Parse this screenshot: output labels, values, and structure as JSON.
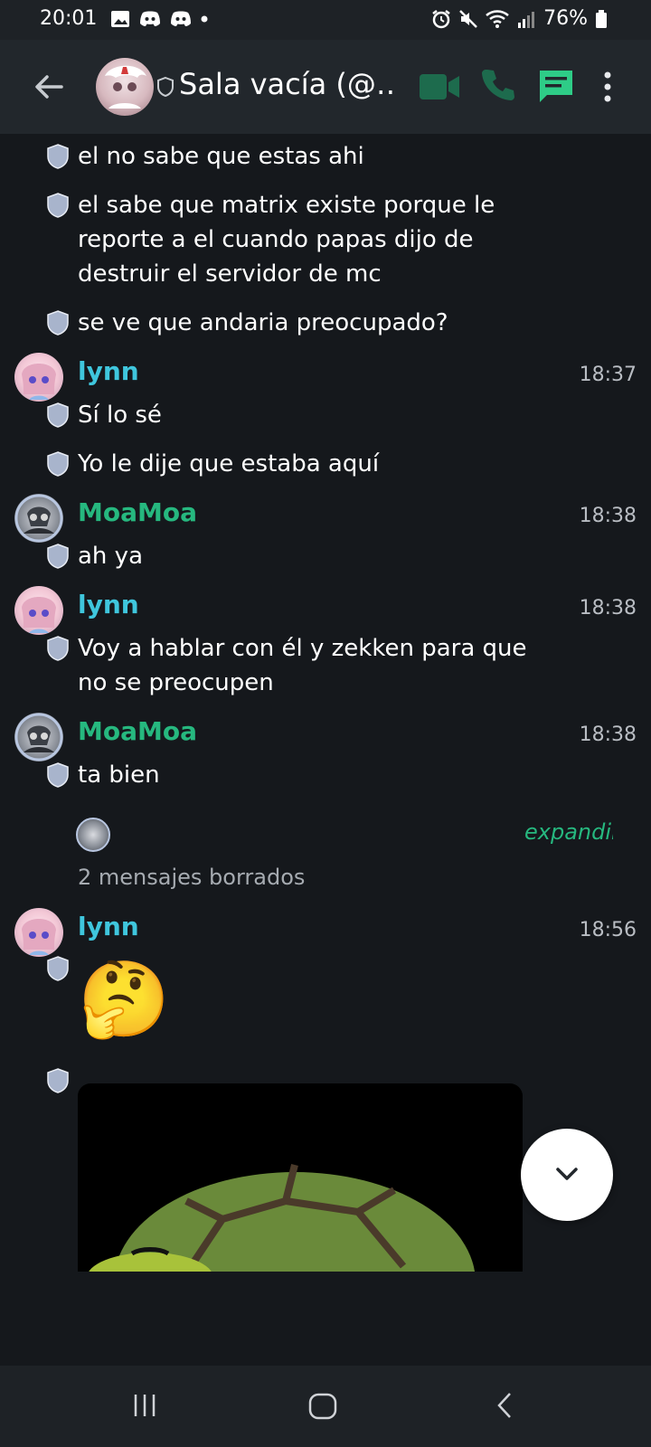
{
  "status_bar": {
    "time": "20:01",
    "battery": "76%"
  },
  "header": {
    "room_title": "Sala vacía (@…"
  },
  "colors": {
    "accent_green": "#26b87f",
    "lynn_name": "#3fc6dd"
  },
  "messages": [
    {
      "text": "el no sabe que estas ahi"
    },
    {
      "text": "el sabe que matrix existe porque le reporte a el cuando papas dijo de destruir el servidor de mc"
    },
    {
      "text": "se ve que andaria preocupado?"
    },
    {
      "sender": "lynn",
      "time": "18:37",
      "text": "Sí lo sé"
    },
    {
      "text": "Yo le dije que estaba aquí"
    },
    {
      "sender": "MoaMoa",
      "time": "18:38",
      "text": "ah ya"
    },
    {
      "sender": "lynn",
      "time": "18:38",
      "text": "Voy a hablar con él y zekken para que no se preocupen"
    },
    {
      "sender": "MoaMoa",
      "time": "18:38",
      "text": "ta bien"
    },
    {
      "sender": "lynn",
      "time": "18:56",
      "text": "🤔"
    }
  ],
  "deleted_group": {
    "expand_label": "expandir",
    "label": "2 mensajes borrados"
  }
}
